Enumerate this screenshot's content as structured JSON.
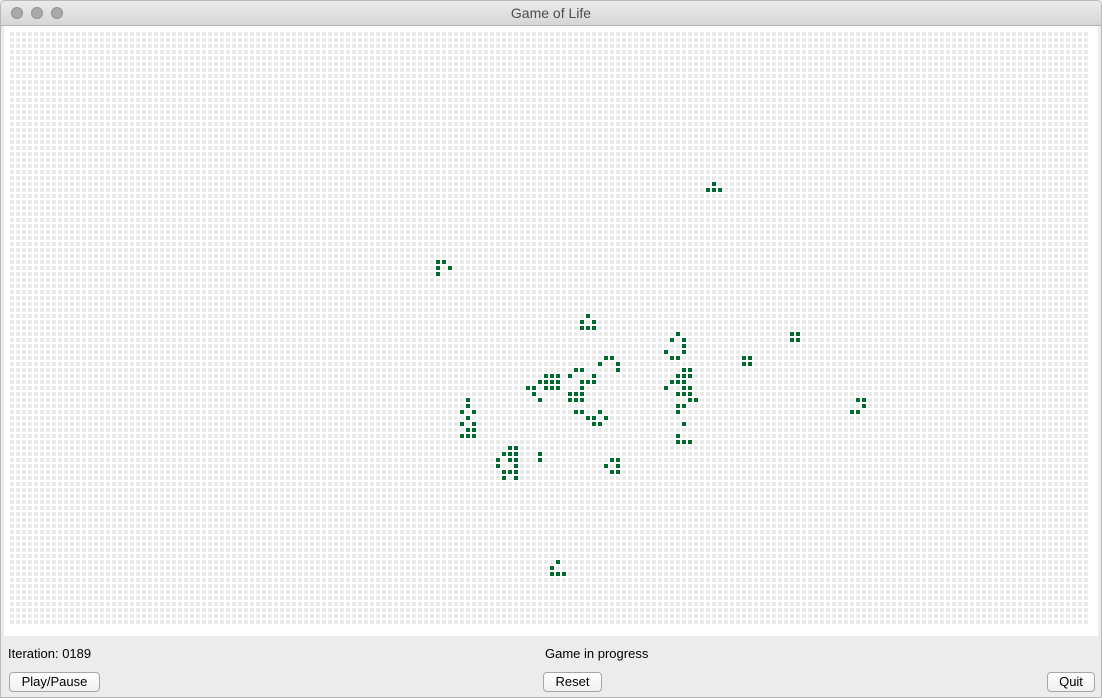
{
  "window": {
    "title": "Game of Life"
  },
  "board": {
    "columns": 180,
    "rows": 99,
    "grid_color": "#e9e9e9",
    "alive_color": "#006a2e",
    "live_cells": [
      [
        117,
        25
      ],
      [
        116,
        26
      ],
      [
        117,
        26
      ],
      [
        118,
        26
      ],
      [
        71,
        38
      ],
      [
        72,
        38
      ],
      [
        71,
        39
      ],
      [
        73,
        39
      ],
      [
        71,
        40
      ],
      [
        96,
        47
      ],
      [
        95,
        48
      ],
      [
        97,
        48
      ],
      [
        95,
        49
      ],
      [
        96,
        49
      ],
      [
        97,
        49
      ],
      [
        111,
        50
      ],
      [
        110,
        51
      ],
      [
        112,
        51
      ],
      [
        112,
        52
      ],
      [
        109,
        53
      ],
      [
        112,
        53
      ],
      [
        110,
        54
      ],
      [
        111,
        54
      ],
      [
        130,
        50
      ],
      [
        131,
        50
      ],
      [
        130,
        51
      ],
      [
        131,
        51
      ],
      [
        99,
        54
      ],
      [
        100,
        54
      ],
      [
        98,
        55
      ],
      [
        101,
        55
      ],
      [
        101,
        56
      ],
      [
        122,
        54
      ],
      [
        123,
        54
      ],
      [
        122,
        55
      ],
      [
        123,
        55
      ],
      [
        94,
        56
      ],
      [
        95,
        56
      ],
      [
        112,
        56
      ],
      [
        113,
        56
      ],
      [
        89,
        57
      ],
      [
        90,
        57
      ],
      [
        91,
        57
      ],
      [
        93,
        57
      ],
      [
        97,
        57
      ],
      [
        111,
        57
      ],
      [
        112,
        57
      ],
      [
        113,
        57
      ],
      [
        88,
        58
      ],
      [
        89,
        58
      ],
      [
        90,
        58
      ],
      [
        91,
        58
      ],
      [
        95,
        58
      ],
      [
        96,
        58
      ],
      [
        97,
        58
      ],
      [
        110,
        58
      ],
      [
        111,
        58
      ],
      [
        112,
        58
      ],
      [
        86,
        59
      ],
      [
        87,
        59
      ],
      [
        89,
        59
      ],
      [
        90,
        59
      ],
      [
        91,
        59
      ],
      [
        95,
        59
      ],
      [
        109,
        59
      ],
      [
        112,
        59
      ],
      [
        113,
        59
      ],
      [
        87,
        60
      ],
      [
        93,
        60
      ],
      [
        94,
        60
      ],
      [
        95,
        60
      ],
      [
        111,
        60
      ],
      [
        112,
        60
      ],
      [
        113,
        60
      ],
      [
        76,
        61
      ],
      [
        88,
        61
      ],
      [
        93,
        61
      ],
      [
        94,
        61
      ],
      [
        95,
        61
      ],
      [
        113,
        61
      ],
      [
        114,
        61
      ],
      [
        76,
        62
      ],
      [
        141,
        61
      ],
      [
        142,
        61
      ],
      [
        142,
        62
      ],
      [
        141,
        63
      ],
      [
        140,
        63
      ],
      [
        75,
        63
      ],
      [
        77,
        63
      ],
      [
        94,
        63
      ],
      [
        95,
        63
      ],
      [
        98,
        63
      ],
      [
        111,
        62
      ],
      [
        112,
        62
      ],
      [
        76,
        64
      ],
      [
        96,
        64
      ],
      [
        97,
        64
      ],
      [
        99,
        64
      ],
      [
        111,
        63
      ],
      [
        75,
        65
      ],
      [
        77,
        65
      ],
      [
        97,
        65
      ],
      [
        98,
        65
      ],
      [
        112,
        65
      ],
      [
        76,
        66
      ],
      [
        77,
        66
      ],
      [
        111,
        68
      ],
      [
        112,
        68
      ],
      [
        113,
        68
      ],
      [
        75,
        67
      ],
      [
        76,
        67
      ],
      [
        77,
        67
      ],
      [
        111,
        67
      ],
      [
        83,
        69
      ],
      [
        84,
        69
      ],
      [
        82,
        70
      ],
      [
        83,
        70
      ],
      [
        84,
        70
      ],
      [
        88,
        70
      ],
      [
        81,
        71
      ],
      [
        83,
        71
      ],
      [
        84,
        71
      ],
      [
        88,
        71
      ],
      [
        81,
        72
      ],
      [
        84,
        72
      ],
      [
        100,
        71
      ],
      [
        101,
        71
      ],
      [
        101,
        72
      ],
      [
        82,
        73
      ],
      [
        83,
        73
      ],
      [
        84,
        73
      ],
      [
        99,
        72
      ],
      [
        101,
        73
      ],
      [
        100,
        73
      ],
      [
        82,
        74
      ],
      [
        84,
        74
      ],
      [
        91,
        88
      ],
      [
        90,
        89
      ],
      [
        90,
        90
      ],
      [
        91,
        90
      ],
      [
        92,
        90
      ]
    ]
  },
  "status": {
    "iteration_label": "Iteration: 0189",
    "message": "Game in progress"
  },
  "buttons": {
    "play_pause": "Play/Pause",
    "reset": "Reset",
    "quit": "Quit"
  }
}
